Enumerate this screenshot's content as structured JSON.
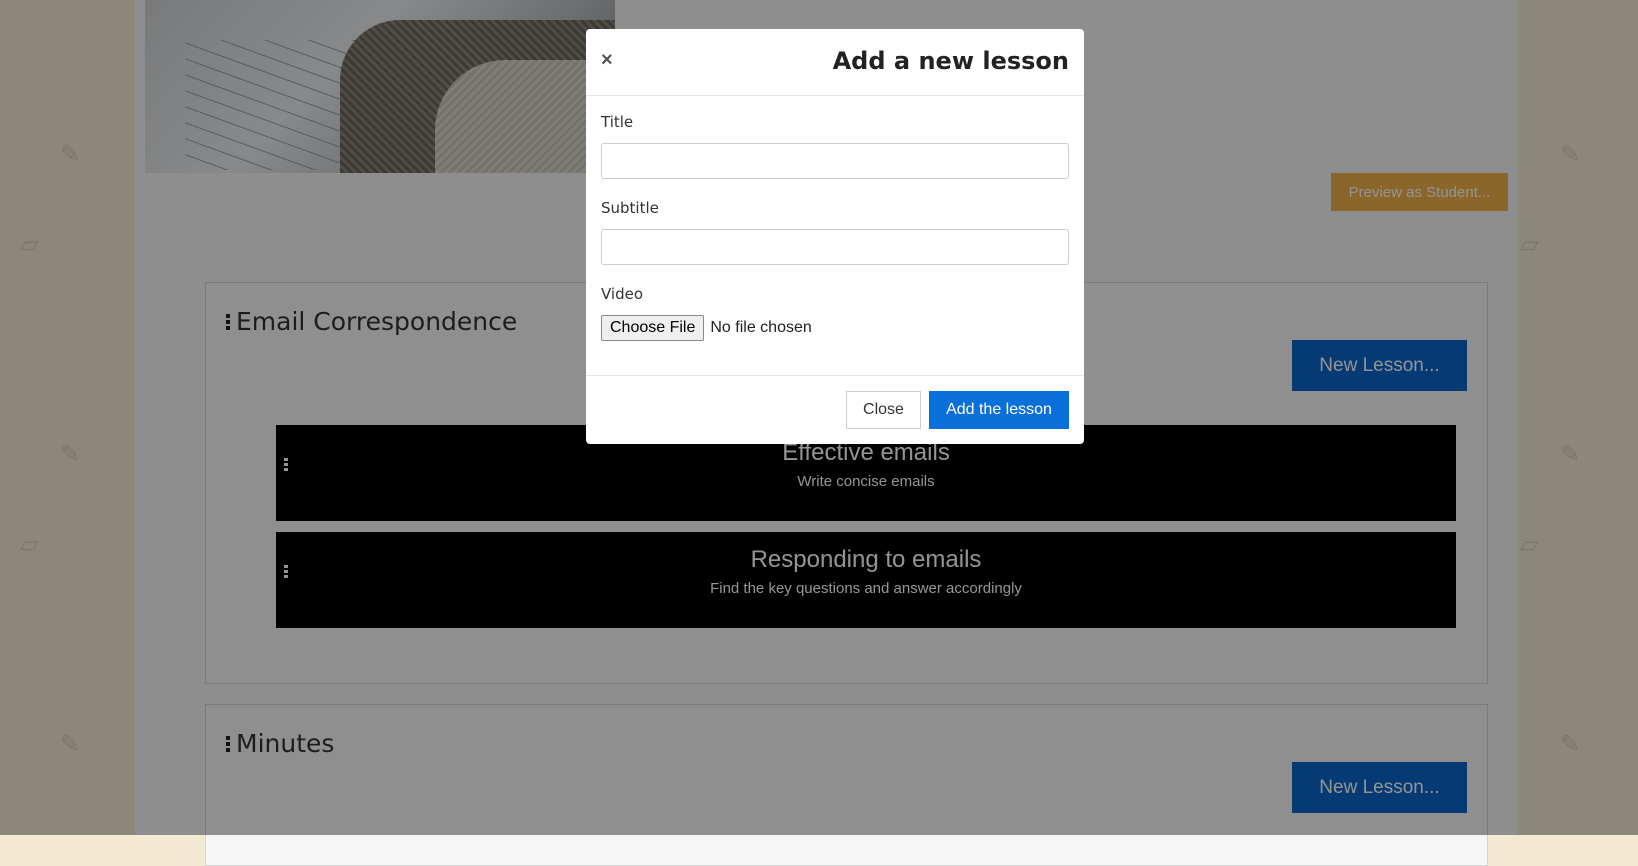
{
  "page": {
    "preview_label": "Preview as Student...",
    "modules": [
      {
        "title": "Email Correspondence",
        "new_lesson_label": "New Lesson...",
        "lessons": [
          {
            "title": "Effective emails",
            "subtitle": "Write concise emails"
          },
          {
            "title": "Responding to emails",
            "subtitle": "Find the key questions and answer accordingly"
          }
        ]
      },
      {
        "title": "Minutes",
        "new_lesson_label": "New Lesson..."
      }
    ]
  },
  "modal": {
    "close_symbol": "×",
    "title": "Add a new lesson",
    "fields": {
      "title_label": "Title",
      "title_value": "",
      "subtitle_label": "Subtitle",
      "subtitle_value": "",
      "video_label": "Video",
      "file_button_label": "Choose File",
      "file_status": "No file chosen"
    },
    "footer": {
      "close_label": "Close",
      "add_label": "Add the lesson"
    }
  },
  "colors": {
    "primary": "#0a64c8",
    "preview": "#f0b04a",
    "background": "#f3e9d3"
  },
  "icons": [
    "close-icon",
    "drag-handle-icon",
    "pencil-icon",
    "book-icon"
  ]
}
